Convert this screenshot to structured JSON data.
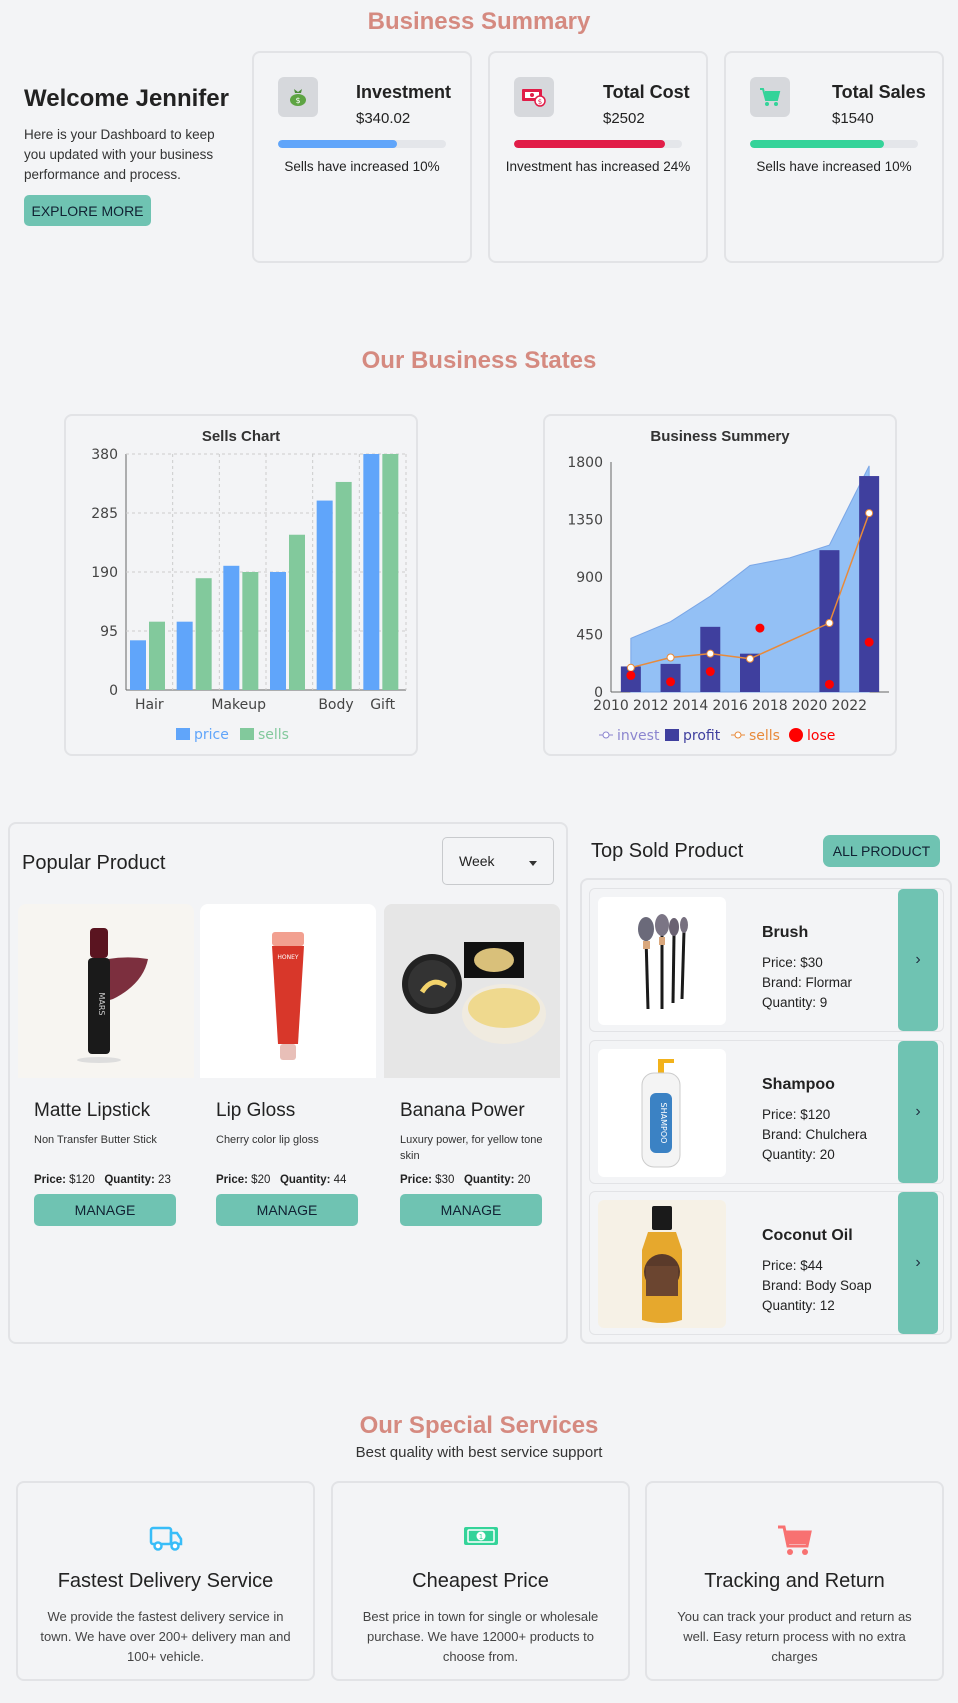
{
  "summary_title": "Business Summary",
  "welcome": {
    "title": "Welcome Jennifer",
    "text": "Here is your Dashboard to keep you updated with your business performance and process.",
    "button": "EXPLORE MORE"
  },
  "stats": [
    {
      "label": "Investment",
      "value": "$340.02",
      "note": "Sells have increased 10%",
      "progress": 0.71,
      "color": "#60a5fa",
      "icon": "money-bag-icon"
    },
    {
      "label": "Total Cost",
      "value": "$2502",
      "note": "Investment has increased 24%",
      "progress": 0.9,
      "color": "#e11d48",
      "icon": "cash-icon"
    },
    {
      "label": "Total Sales",
      "value": "$1540",
      "note": "Sells have increased 10%",
      "progress": 0.8,
      "color": "#34d399",
      "icon": "cart-icon"
    }
  ],
  "states_title": "Our Business States",
  "chart_data": [
    {
      "type": "bar",
      "title": "Sells Chart",
      "categories": [
        "Hair",
        "",
        "Makeup",
        "",
        "Body",
        "Gift"
      ],
      "series": [
        {
          "name": "price",
          "values": [
            80,
            110,
            200,
            190,
            305,
            380
          ],
          "color": "#60a5fa"
        },
        {
          "name": "sells",
          "values": [
            110,
            180,
            190,
            250,
            335,
            380
          ],
          "color": "#82c99c"
        }
      ],
      "yticks": [
        0,
        95,
        190,
        285,
        380
      ],
      "ylim": [
        0,
        380
      ],
      "grid": true,
      "legend": "bottom"
    },
    {
      "type": "line",
      "title": "Business Summery",
      "x": [
        2011,
        2013,
        2015,
        2017,
        2019,
        2021,
        2023
      ],
      "xticks": [
        2010,
        2012,
        2014,
        2016,
        2018,
        2020,
        2022
      ],
      "series": [
        {
          "name": "invest",
          "type": "area",
          "values": [
            420,
            550,
            750,
            990,
            1050,
            1150,
            1770
          ],
          "color": "#93c0f5"
        },
        {
          "name": "profit",
          "type": "bar",
          "values": [
            200,
            220,
            510,
            300,
            1110,
            1690
          ],
          "x": [
            2011,
            2013,
            2015,
            2017,
            2021,
            2023
          ],
          "color": "#3f3f9e"
        },
        {
          "name": "sells",
          "type": "line",
          "values": [
            190,
            270,
            300,
            260,
            540,
            1400
          ],
          "x": [
            2011,
            2013,
            2015,
            2017,
            2021,
            2023
          ],
          "color": "#e88a3a"
        },
        {
          "name": "lose",
          "type": "scatter",
          "values": [
            130,
            80,
            160,
            500,
            60,
            390
          ],
          "x": [
            2011,
            2013,
            2015,
            2017.5,
            2021,
            2023
          ],
          "color": "#ff0000"
        }
      ],
      "yticks": [
        0,
        450,
        900,
        1350,
        1800
      ],
      "ylim": [
        0,
        1800
      ],
      "xlim": [
        2010,
        2024
      ],
      "legend": "bottom"
    }
  ],
  "popular": {
    "title": "Popular Product",
    "filter": "Week",
    "price_label": "Price:",
    "qty_label": "Quantity:",
    "button": "MANAGE",
    "items": [
      {
        "name": "Matte Lipstick",
        "desc": "Non Transfer Butter Stick",
        "price": "$120",
        "qty": "23"
      },
      {
        "name": "Lip Gloss",
        "desc": "Cherry color lip gloss",
        "price": "$20",
        "qty": "44"
      },
      {
        "name": "Banana Power",
        "desc": "Luxury power, for yellow tone skin",
        "price": "$30",
        "qty": "20"
      }
    ]
  },
  "top_sold": {
    "title": "Top Sold Product",
    "button": "ALL PRODUCT",
    "items": [
      {
        "name": "Brush",
        "price": "Price: $30",
        "brand": "Brand: Flormar",
        "qty": "Quantity: 9"
      },
      {
        "name": "Shampoo",
        "price": "Price: $120",
        "brand": "Brand: Chulchera",
        "qty": "Quantity: 20"
      },
      {
        "name": "Coconut Oil",
        "price": "Price: $44",
        "brand": "Brand: Body Soap",
        "qty": "Quantity: 12"
      }
    ]
  },
  "services": {
    "title": "Our Special Services",
    "subtitle": "Best quality with best service support",
    "items": [
      {
        "title": "Fastest Delivery Service",
        "desc": "We provide the fastest delivery service in town. We have over 200+ delivery man and 100+ vehicle.",
        "icon": "truck-icon",
        "color": "#38bdf8"
      },
      {
        "title": "Cheapest Price",
        "desc": "Best price in town for single or wholesale purchase. We have 12000+ products to choose from.",
        "icon": "money-icon",
        "color": "#34d399"
      },
      {
        "title": "Tracking and Return",
        "desc": "You can track your product and return as well. Easy return process with no extra charges",
        "icon": "cart-icon",
        "color": "#f87171"
      }
    ]
  }
}
